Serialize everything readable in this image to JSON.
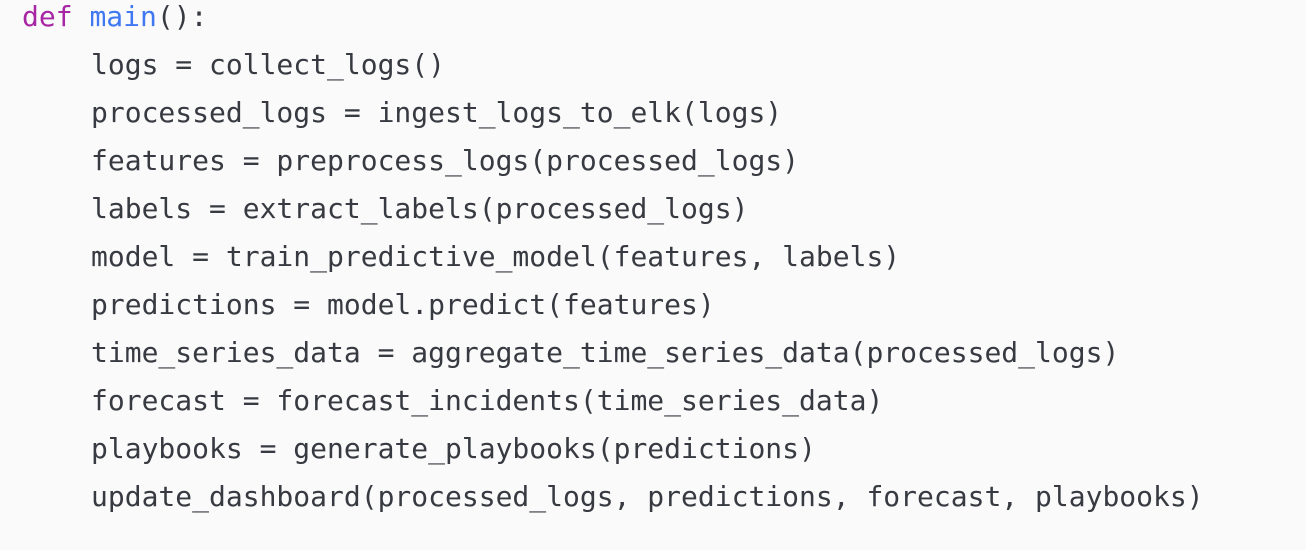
{
  "code": {
    "signature": {
      "keyword": "def",
      "space": " ",
      "name": "main",
      "rest": "():"
    },
    "body_lines": [
      "logs = collect_logs()",
      "processed_logs = ingest_logs_to_elk(logs)",
      "features = preprocess_logs(processed_logs)",
      "labels = extract_labels(processed_logs)",
      "model = train_predictive_model(features, labels)",
      "predictions = model.predict(features)",
      "time_series_data = aggregate_time_series_data(processed_logs)",
      "forecast = forecast_incidents(time_series_data)",
      "playbooks = generate_playbooks(predictions)",
      "update_dashboard(processed_logs, predictions, forecast, playbooks)"
    ]
  },
  "colors": {
    "background": "#fafafa",
    "text": "#383a42",
    "keyword": "#a626a4",
    "function_name": "#4078f2"
  }
}
